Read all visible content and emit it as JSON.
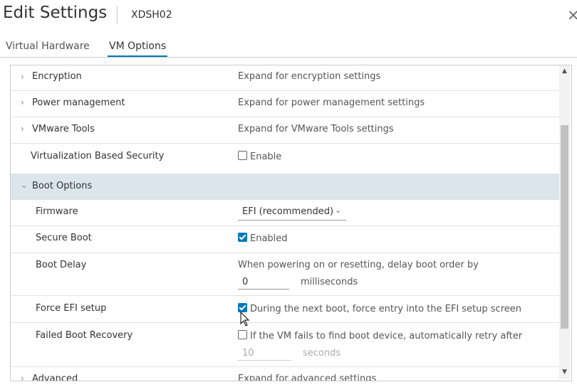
{
  "dialog": {
    "title": "Edit Settings",
    "vm_name": "XDSH02",
    "close_glyph": "×"
  },
  "tabs": [
    {
      "label": "Virtual Hardware",
      "active": false
    },
    {
      "label": "VM Options",
      "active": true
    }
  ],
  "rows": {
    "encryption": {
      "label": "Encryption",
      "value": "Expand for encryption settings"
    },
    "power": {
      "label": "Power management",
      "value": "Expand for power management settings"
    },
    "tools": {
      "label": "VMware Tools",
      "value": "Expand for VMware Tools settings"
    },
    "vbs": {
      "label": "Virtualization Based Security",
      "checkbox_label": "Enable",
      "checked": false
    },
    "boot": {
      "label": "Boot Options"
    },
    "firmware": {
      "label": "Firmware",
      "selected": "EFI (recommended)"
    },
    "secure_boot": {
      "label": "Secure Boot",
      "checkbox_label": "Enabled",
      "checked": true
    },
    "boot_delay": {
      "label": "Boot Delay",
      "description": "When powering on or resetting, delay boot order by",
      "value": "0",
      "unit": "milliseconds"
    },
    "force_efi": {
      "label": "Force EFI setup",
      "checkbox_label": "During the next boot, force entry into the EFI setup screen",
      "checked": true
    },
    "failed_boot": {
      "label": "Failed Boot Recovery",
      "checkbox_label": "If the VM fails to find boot device, automatically retry after",
      "checked": false,
      "value": "10",
      "unit": "seconds"
    },
    "advanced": {
      "label": "Advanced",
      "value": "Expand for advanced settings"
    }
  },
  "icons": {
    "chevron_right": "›",
    "chevron_down": "⌄",
    "scroll_up": "▲",
    "scroll_down": "▼"
  }
}
